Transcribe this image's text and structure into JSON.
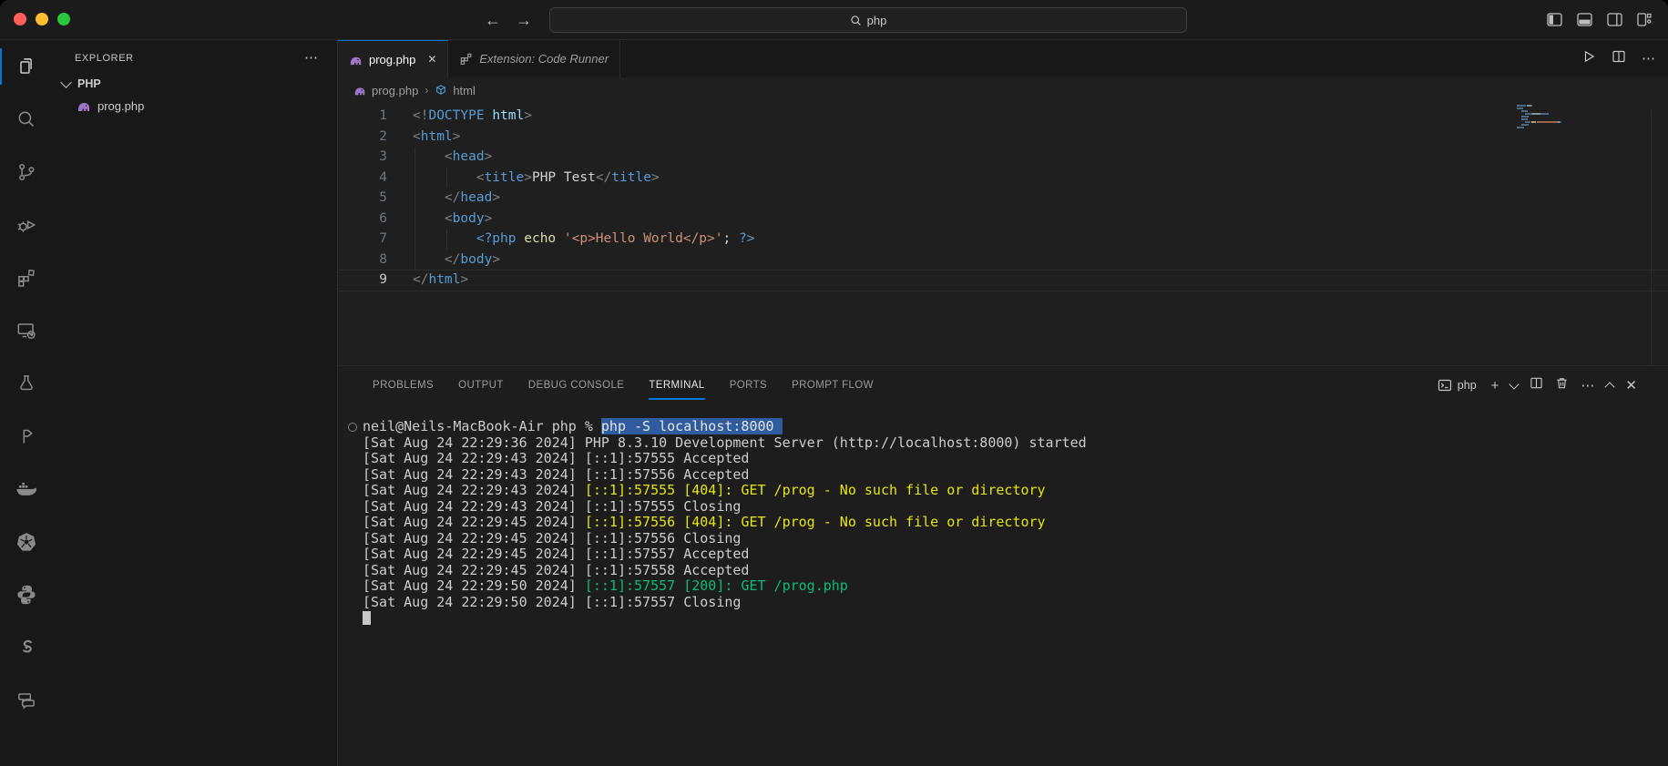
{
  "titlebar": {
    "search_value": "php",
    "back_arrow": "←",
    "forward_arrow": "→",
    "window_buttons": [
      "close",
      "minimize",
      "zoom"
    ],
    "layout_icons": [
      "toggle-primary-sidebar-icon",
      "toggle-panel-icon",
      "toggle-secondary-sidebar-icon",
      "customize-layout-icon"
    ]
  },
  "activity_bar": {
    "items": [
      {
        "name": "explorer-icon",
        "active": true
      },
      {
        "name": "search-icon",
        "active": false
      },
      {
        "name": "source-control-icon",
        "active": false
      },
      {
        "name": "run-and-debug-icon",
        "active": false
      },
      {
        "name": "extensions-icon",
        "active": false
      },
      {
        "name": "remote-explorer-icon",
        "active": false
      },
      {
        "name": "testing-icon",
        "active": false
      },
      {
        "name": "prompt-flow-icon",
        "active": false
      },
      {
        "name": "docker-icon",
        "active": false
      },
      {
        "name": "kubernetes-icon",
        "active": false
      },
      {
        "name": "python-icon",
        "active": false
      },
      {
        "name": "s-extension-icon",
        "active": false
      },
      {
        "name": "comments-icon",
        "active": false
      }
    ]
  },
  "sidebar": {
    "header": "EXPLORER",
    "more_label": "⋯",
    "folder": "PHP",
    "files": [
      {
        "name": "prog.php",
        "icon": "php-file-icon"
      }
    ]
  },
  "editor": {
    "tabs": [
      {
        "label": "prog.php",
        "icon": "php-file-icon",
        "active": true,
        "close_glyph": "✕"
      },
      {
        "label": "Extension: Code Runner",
        "icon": "extension-icon",
        "active": false
      }
    ],
    "breadcrumb": {
      "file": "prog.php",
      "separator": "›",
      "symbol": "html"
    },
    "active_line": 9,
    "code_lines": [
      {
        "num": 1,
        "guides": [],
        "tokens": [
          [
            "p",
            "<!"
          ],
          [
            "t",
            "DOCTYPE"
          ],
          [
            "w",
            " "
          ],
          [
            "a",
            "html"
          ],
          [
            "p",
            ">"
          ]
        ]
      },
      {
        "num": 2,
        "guides": [],
        "tokens": [
          [
            "p",
            "<"
          ],
          [
            "t",
            "html"
          ],
          [
            "p",
            ">"
          ]
        ]
      },
      {
        "num": 3,
        "guides": [
          0
        ],
        "tokens": [
          [
            "w",
            "    "
          ],
          [
            "p",
            "<"
          ],
          [
            "t",
            "head"
          ],
          [
            "p",
            ">"
          ]
        ]
      },
      {
        "num": 4,
        "guides": [
          0,
          1
        ],
        "tokens": [
          [
            "w",
            "        "
          ],
          [
            "p",
            "<"
          ],
          [
            "t",
            "title"
          ],
          [
            "p",
            ">"
          ],
          [
            "w",
            "PHP Test"
          ],
          [
            "p",
            "</"
          ],
          [
            "t",
            "title"
          ],
          [
            "p",
            ">"
          ]
        ]
      },
      {
        "num": 5,
        "guides": [
          0
        ],
        "tokens": [
          [
            "w",
            "    "
          ],
          [
            "p",
            "</"
          ],
          [
            "t",
            "head"
          ],
          [
            "p",
            ">"
          ]
        ]
      },
      {
        "num": 6,
        "guides": [
          0
        ],
        "tokens": [
          [
            "w",
            "    "
          ],
          [
            "p",
            "<"
          ],
          [
            "t",
            "body"
          ],
          [
            "p",
            ">"
          ]
        ]
      },
      {
        "num": 7,
        "guides": [
          0,
          1
        ],
        "tokens": [
          [
            "w",
            "        "
          ],
          [
            "k",
            "<?php"
          ],
          [
            "w",
            " "
          ],
          [
            "f",
            "echo"
          ],
          [
            "w",
            " "
          ],
          [
            "s",
            "'<p>Hello World</p>'"
          ],
          [
            "w",
            "; "
          ],
          [
            "k",
            "?>"
          ]
        ]
      },
      {
        "num": 8,
        "guides": [
          0
        ],
        "tokens": [
          [
            "w",
            "    "
          ],
          [
            "p",
            "</"
          ],
          [
            "t",
            "body"
          ],
          [
            "p",
            ">"
          ]
        ]
      },
      {
        "num": 9,
        "guides": [],
        "tokens": [
          [
            "p",
            "</"
          ],
          [
            "t",
            "html"
          ],
          [
            "p",
            ">"
          ]
        ]
      }
    ]
  },
  "panel": {
    "tabs": [
      {
        "label": "PROBLEMS",
        "active": false
      },
      {
        "label": "OUTPUT",
        "active": false
      },
      {
        "label": "DEBUG CONSOLE",
        "active": false
      },
      {
        "label": "TERMINAL",
        "active": true
      },
      {
        "label": "PORTS",
        "active": false
      },
      {
        "label": "PROMPT FLOW",
        "active": false
      }
    ],
    "shell_label": "php",
    "controls": [
      "new-terminal-icon",
      "launch-profile-chevron-icon",
      "split-terminal-icon",
      "kill-terminal-icon",
      "more-actions-icon",
      "maximize-panel-icon",
      "close-panel-icon"
    ],
    "plus_glyph": "+",
    "more_glyph": "⋯",
    "close_glyph": "✕",
    "terminal": {
      "lines": [
        [
          [
            "fg",
            "neil@Neils-MacBook-Air php % "
          ],
          [
            "sel",
            "php -S localhost:8000 "
          ]
        ],
        [
          [
            "fg",
            "[Sat Aug 24 22:29:36 2024] PHP 8.3.10 Development Server (http://localhost:8000) started"
          ]
        ],
        [
          [
            "fg",
            "[Sat Aug 24 22:29:43 2024] [::1]:57555 Accepted"
          ]
        ],
        [
          [
            "fg",
            "[Sat Aug 24 22:29:43 2024] [::1]:57556 Accepted"
          ]
        ],
        [
          [
            "fg",
            "[Sat Aug 24 22:29:43 2024] "
          ],
          [
            "y",
            "[::1]:57555 [404]: GET /prog - No such file or directory"
          ]
        ],
        [
          [
            "fg",
            "[Sat Aug 24 22:29:43 2024] [::1]:57555 Closing"
          ]
        ],
        [
          [
            "fg",
            "[Sat Aug 24 22:29:45 2024] "
          ],
          [
            "y",
            "[::1]:57556 [404]: GET /prog - No such file or directory"
          ]
        ],
        [
          [
            "fg",
            "[Sat Aug 24 22:29:45 2024] [::1]:57556 Closing"
          ]
        ],
        [
          [
            "fg",
            "[Sat Aug 24 22:29:45 2024] [::1]:57557 Accepted"
          ]
        ],
        [
          [
            "fg",
            "[Sat Aug 24 22:29:45 2024] [::1]:57558 Accepted"
          ]
        ],
        [
          [
            "fg",
            "[Sat Aug 24 22:29:50 2024] "
          ],
          [
            "g",
            "[::1]:57557 [200]: GET /prog.php"
          ]
        ],
        [
          [
            "fg",
            "[Sat Aug 24 22:29:50 2024] [::1]:57557 Closing"
          ]
        ]
      ],
      "cursor": true
    }
  },
  "colors": {
    "accent": "#0078d4",
    "editor_bg": "#1f1f1f",
    "sidebar_bg": "#181818",
    "selection_bg": "#2e5c9e",
    "ansi_yellow": "#e5e510",
    "ansi_green": "#0dbc79"
  }
}
